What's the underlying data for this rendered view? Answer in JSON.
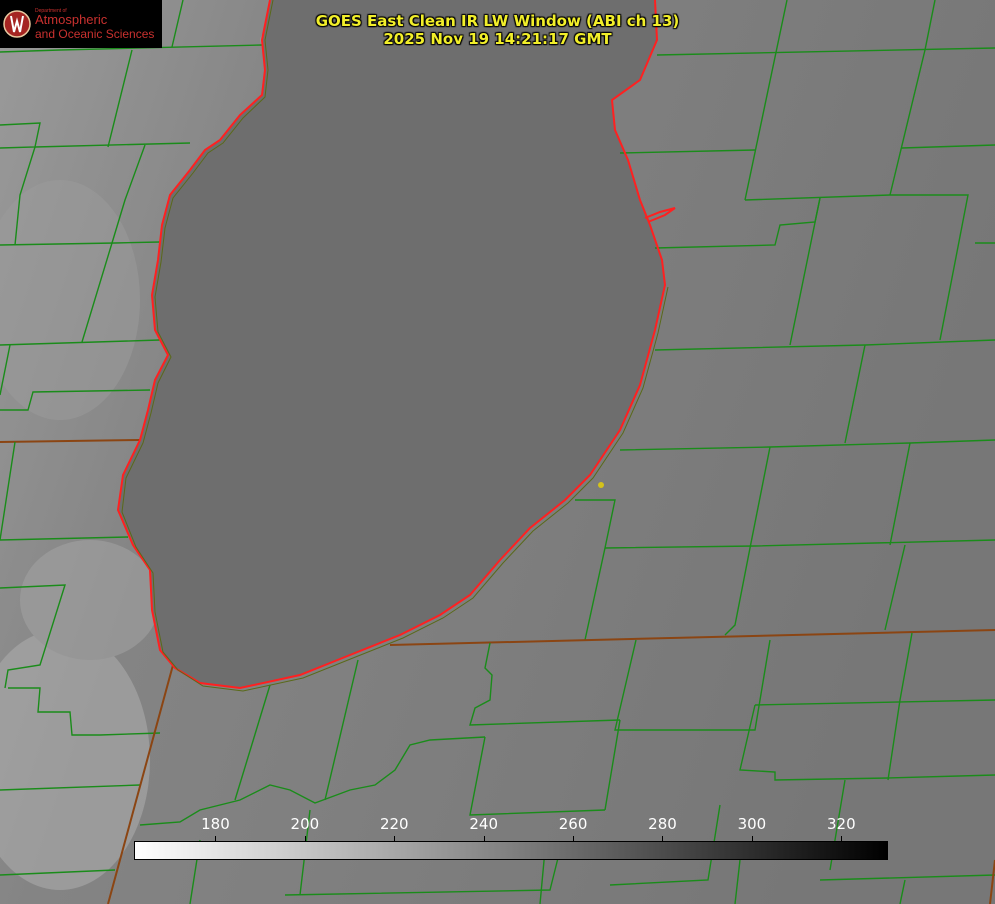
{
  "logo": {
    "small_text": "Department of",
    "line1": "Atmospheric",
    "line2": "and Oceanic Sciences",
    "shield_letter": "W"
  },
  "title": {
    "line1": "GOES East Clean IR LW Window (ABI ch 13)",
    "line2": "2025 Nov 19 14:21:17 GMT"
  },
  "colorbar": {
    "range": [
      162,
      330
    ],
    "ticks": [
      "180",
      "200",
      "220",
      "240",
      "260",
      "280",
      "300",
      "320"
    ],
    "tick_values": [
      180,
      200,
      220,
      240,
      260,
      280,
      300,
      320
    ],
    "gradient": [
      "#ffffff",
      "#000000"
    ]
  },
  "colors": {
    "background_gray": "#7a7a7a",
    "lake_gray": "#6e6e6e",
    "county_lines": "#1a8c1a",
    "state_lines": "#8b4513",
    "coastline": "#ff2020",
    "title_text": "#f2ef2a",
    "marker": "#d4c21a",
    "logo_text": "#c9312f"
  }
}
